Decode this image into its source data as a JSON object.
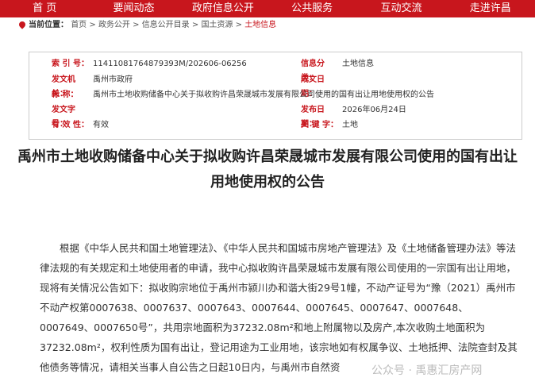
{
  "nav": [
    "首 页",
    "要闻动态",
    "政府信息公开",
    "公共服务",
    "互动交流",
    "走进许昌"
  ],
  "breadcrumb": {
    "label": "当前位置：",
    "items": [
      "首页",
      "政务公开",
      "信息公开目录",
      "国土资源"
    ],
    "current": "土地信息"
  },
  "meta": {
    "index_k": "索 引 号：",
    "index_v": "11411081764879393M/202606-06256",
    "cat_k": "信息分类：",
    "cat_v": "土地信息",
    "org_k": "发文机关：",
    "org_v": "禹州市政府",
    "date_k": "成文日期：",
    "date_v": "",
    "title_k": "标 称：",
    "title_v": "禹州市土地收购储备中心关于拟收购许昌荣晟城市发展有限公司使用的国有出让用地使用权的公告",
    "doc_k": "发文字号：",
    "doc_v": "",
    "pub_k": "发布日期：",
    "pub_v": "2026年06月24日",
    "valid_k": "有 效 性：",
    "valid_v": "有效",
    "kw_k": "关 键 字：",
    "kw_v": "土地"
  },
  "title": "禹州市土地收购储备中心关于拟收购许昌荣晟城市发展有限公司使用的国有出让用地使用权的公告",
  "body": "根据《中华人民共和国土地管理法》、《中华人民共和国城市房地产管理法》及《土地储备管理办法》等法律法规的有关规定和土地使用者的申请，我中心拟收购许昌荣晟城市发展有限公司使用的一宗国有出让用地，现将有关情况公告如下：拟收购宗地位于禹州市颍川办和谐大街29号1幢，不动产证号为“豫（2021）禹州市不动产权第0007638、0007637、0007643、0007644、0007645、0007647、0007648、0007649、0007650号”，共用宗地面积为37232.08m²和地上附属物以及房产,本次收购土地面积为37232.08m²，权利性质为国有出让，登记用途为工业用地，该宗地如有权属争议、土地抵押、法院查封及其他债务等情况，请相关当事人自公告之日起10日内，与禹州市自然资",
  "watermark": "公众号 · 禹惠汇房产网"
}
